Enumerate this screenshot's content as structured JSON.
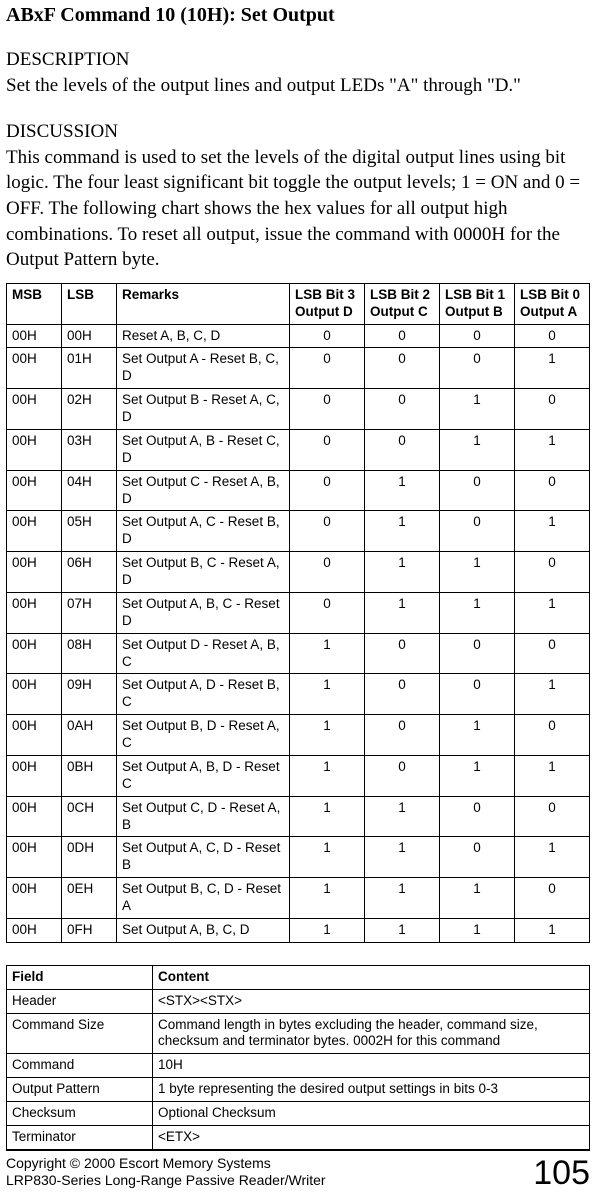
{
  "title": "ABxF Command 10 (10H): Set Output",
  "description_head": "DESCRIPTION",
  "description_body": "Set the levels of the output lines and output LEDs \"A\" through \"D.\"",
  "discussion_head": "DISCUSSION",
  "discussion_body": "This command is used to set the levels of the digital output lines using bit logic. The four least significant bit toggle the output levels; 1 = ON and 0 = OFF. The following chart shows the hex values for all output high combinations. To reset all output, issue the command with 0000H for the Output Pattern byte.",
  "bits_table": {
    "headers": {
      "msb": "MSB",
      "lsb": "LSB",
      "remarks": "Remarks",
      "bit3": "LSB Bit 3 Output D",
      "bit2": "LSB Bit 2 Output C",
      "bit1": "LSB Bit 1 Output B",
      "bit0": "LSB Bit 0 Output A"
    },
    "rows": [
      {
        "msb": "00H",
        "lsb": "00H",
        "remarks": "Reset A, B, C, D",
        "b3": "0",
        "b2": "0",
        "b1": "0",
        "b0": "0"
      },
      {
        "msb": "00H",
        "lsb": "01H",
        "remarks": "Set Output A - Reset B, C, D",
        "b3": "0",
        "b2": "0",
        "b1": "0",
        "b0": "1"
      },
      {
        "msb": "00H",
        "lsb": "02H",
        "remarks": "Set Output B - Reset A, C, D",
        "b3": "0",
        "b2": "0",
        "b1": "1",
        "b0": "0"
      },
      {
        "msb": "00H",
        "lsb": "03H",
        "remarks": "Set Output A, B - Reset C, D",
        "b3": "0",
        "b2": "0",
        "b1": "1",
        "b0": "1"
      },
      {
        "msb": "00H",
        "lsb": "04H",
        "remarks": "Set Output C - Reset A, B, D",
        "b3": "0",
        "b2": "1",
        "b1": "0",
        "b0": "0"
      },
      {
        "msb": "00H",
        "lsb": "05H",
        "remarks": "Set Output A, C - Reset B, D",
        "b3": "0",
        "b2": "1",
        "b1": "0",
        "b0": "1"
      },
      {
        "msb": "00H",
        "lsb": "06H",
        "remarks": "Set Output B, C - Reset A, D",
        "b3": "0",
        "b2": "1",
        "b1": "1",
        "b0": "0"
      },
      {
        "msb": "00H",
        "lsb": "07H",
        "remarks": "Set Output A, B, C - Reset D",
        "b3": "0",
        "b2": "1",
        "b1": "1",
        "b0": "1"
      },
      {
        "msb": "00H",
        "lsb": "08H",
        "remarks": "Set Output D - Reset A, B, C",
        "b3": "1",
        "b2": "0",
        "b1": "0",
        "b0": "0"
      },
      {
        "msb": "00H",
        "lsb": "09H",
        "remarks": "Set Output A, D - Reset B, C",
        "b3": "1",
        "b2": "0",
        "b1": "0",
        "b0": "1"
      },
      {
        "msb": "00H",
        "lsb": "0AH",
        "remarks": "Set Output B, D - Reset A, C",
        "b3": "1",
        "b2": "0",
        "b1": "1",
        "b0": "0"
      },
      {
        "msb": "00H",
        "lsb": "0BH",
        "remarks": "Set Output A, B, D - Reset C",
        "b3": "1",
        "b2": "0",
        "b1": "1",
        "b0": "1"
      },
      {
        "msb": "00H",
        "lsb": "0CH",
        "remarks": "Set Output C, D  - Reset A, B",
        "b3": "1",
        "b2": "1",
        "b1": "0",
        "b0": "0"
      },
      {
        "msb": "00H",
        "lsb": "0DH",
        "remarks": "Set Output A, C, D - Reset B",
        "b3": "1",
        "b2": "1",
        "b1": "0",
        "b0": "1"
      },
      {
        "msb": "00H",
        "lsb": "0EH",
        "remarks": "Set Output B, C, D - Reset A",
        "b3": "1",
        "b2": "1",
        "b1": "1",
        "b0": "0"
      },
      {
        "msb": "00H",
        "lsb": "0FH",
        "remarks": "Set Output A, B, C, D",
        "b3": "1",
        "b2": "1",
        "b1": "1",
        "b0": "1"
      }
    ]
  },
  "field_table": {
    "headers": {
      "field": "Field",
      "content": "Content"
    },
    "rows": [
      {
        "field": "Header",
        "content": "<STX><STX>"
      },
      {
        "field": "Command Size",
        "content": "Command length in bytes excluding the header, command size, checksum and terminator bytes. 0002H for this command"
      },
      {
        "field": "Command",
        "content": "10H"
      },
      {
        "field": "Output Pattern",
        "content": "1 byte representing the desired output settings in bits 0-3"
      },
      {
        "field": "Checksum",
        "content": "Optional Checksum"
      },
      {
        "field": "Terminator",
        "content": "<ETX>"
      }
    ]
  },
  "footer": {
    "line1": "Copyright © 2000 Escort Memory Systems",
    "line2": "LRP830-Series Long-Range Passive Reader/Writer",
    "page_number": "105"
  }
}
